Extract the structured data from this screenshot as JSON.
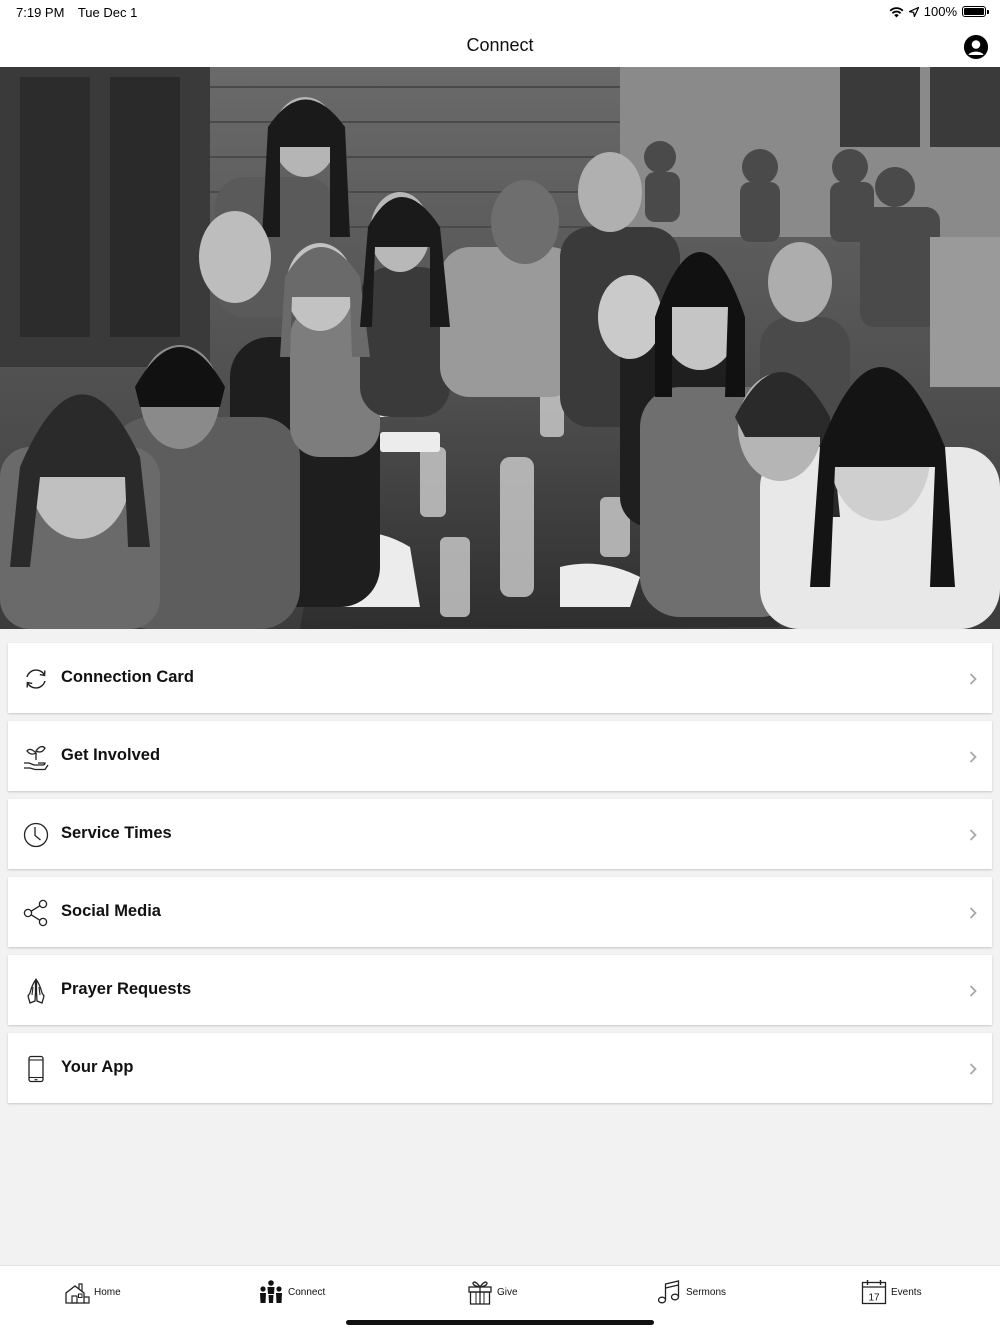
{
  "status_bar": {
    "time": "7:19 PM",
    "date": "Tue Dec 1",
    "battery": "100%",
    "battery_level": 1.0
  },
  "nav": {
    "title": "Connect",
    "profile_icon": "user-circle-icon"
  },
  "hero": {
    "description_icon": "group-photo"
  },
  "menu": [
    {
      "label": "Connection Card",
      "icon": "sync-arrows-icon"
    },
    {
      "label": "Get Involved",
      "icon": "hand-plant-icon"
    },
    {
      "label": "Service Times",
      "icon": "clock-icon"
    },
    {
      "label": "Social Media",
      "icon": "share-icon"
    },
    {
      "label": "Prayer Requests",
      "icon": "praying-hands-icon"
    },
    {
      "label": "Your App",
      "icon": "phone-icon"
    }
  ],
  "tabs": [
    {
      "label": "Home",
      "icon": "house-icon"
    },
    {
      "label": "Connect",
      "icon": "people-icon"
    },
    {
      "label": "Give",
      "icon": "gift-icon"
    },
    {
      "label": "Sermons",
      "icon": "music-note-icon"
    },
    {
      "label": "Events",
      "icon": "calendar-icon",
      "calendar_day": "17"
    }
  ]
}
